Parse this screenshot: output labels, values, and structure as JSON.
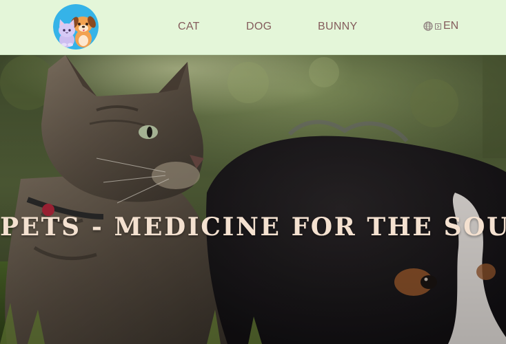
{
  "header": {
    "logo_name": "cat-and-dog-logo",
    "nav": [
      {
        "label": "CAT"
      },
      {
        "label": "DOG"
      },
      {
        "label": "BUNNY"
      }
    ],
    "language": {
      "label": "EN",
      "icon": "globe-icon"
    }
  },
  "hero": {
    "title": "PETS - MEDICINE FOR THE SOUL",
    "image": "cat-and-puppy-photo"
  },
  "colors": {
    "header_bg": "#e4f6d9",
    "nav_text": "#845c5c",
    "hero_title": "#f4e1d0"
  }
}
